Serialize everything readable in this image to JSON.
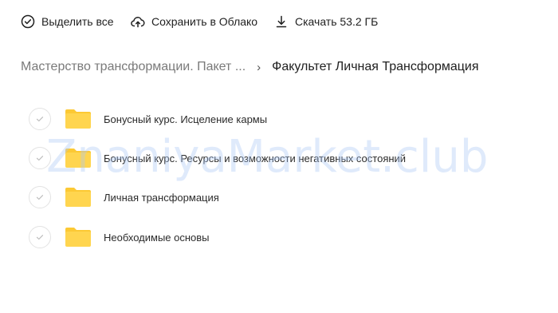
{
  "toolbar": {
    "select_all_label": "Выделить все",
    "save_cloud_label": "Сохранить в Облако",
    "download_label": "Скачать 53.2 ГБ"
  },
  "breadcrumb": {
    "parent": "Мастерство трансформации. Пакет ...",
    "separator": "›",
    "current": "Факультет Личная Трансформация"
  },
  "items": [
    {
      "label": "Бонусный курс. Исцеление кармы"
    },
    {
      "label": "Бонусный курс. Ресурсы и возможности негативных состояний"
    },
    {
      "label": "Личная трансформация"
    },
    {
      "label": "Необходимые основы"
    }
  ],
  "watermark": "ZnaniyaMarket.club",
  "colors": {
    "folder": "#ffd54f",
    "folder_tab": "#fcc934",
    "check_border": "#e3e3e3",
    "breadcrumb_parent": "#7a7a7a"
  }
}
